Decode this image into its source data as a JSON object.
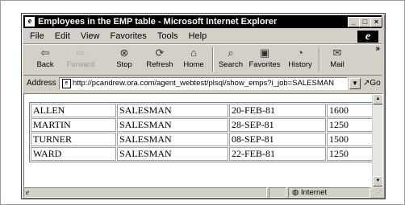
{
  "window": {
    "title": "Employees in the EMP table - Microsoft Internet Explorer",
    "app_icon_glyph": "e",
    "minimize_glyph": "_",
    "maximize_glyph": "□",
    "close_glyph": "×"
  },
  "menu": [
    "File",
    "Edit",
    "View",
    "Favorites",
    "Tools",
    "Help"
  ],
  "ie_logo": "e",
  "toolbar": {
    "buttons": [
      {
        "label": "Back",
        "icon": "back-arrow-icon",
        "glyph": "⇦"
      },
      {
        "label": "Forward",
        "icon": "forward-arrow-icon",
        "glyph": "⇨"
      },
      {
        "label": "Stop",
        "icon": "stop-icon",
        "glyph": "⊗"
      },
      {
        "label": "Refresh",
        "icon": "refresh-icon",
        "glyph": "⟳"
      },
      {
        "label": "Home",
        "icon": "home-icon",
        "glyph": "⌂"
      },
      {
        "label": "Search",
        "icon": "search-icon",
        "glyph": "⌕"
      },
      {
        "label": "Favorites",
        "icon": "favorites-icon",
        "glyph": "▣"
      },
      {
        "label": "History",
        "icon": "history-icon",
        "glyph": "◔"
      },
      {
        "label": "Mail",
        "icon": "mail-icon",
        "glyph": "✉"
      }
    ],
    "more_glyph": "»"
  },
  "address": {
    "label": "Address",
    "url": "http://pcandrew.ora.com/agent_webtest/plsql/show_emps?i_job=SALESMAN",
    "go_label": "Go",
    "go_glyph": "↗"
  },
  "employees": {
    "rows": [
      [
        "ALLEN",
        "SALESMAN",
        "20-FEB-81",
        "1600"
      ],
      [
        "MARTIN",
        "SALESMAN",
        "28-SEP-81",
        "1250"
      ],
      [
        "TURNER",
        "SALESMAN",
        "08-SEP-81",
        "1500"
      ],
      [
        "WARD",
        "SALESMAN",
        "22-FEB-81",
        "1250"
      ]
    ]
  },
  "status": {
    "zone": "Internet"
  }
}
